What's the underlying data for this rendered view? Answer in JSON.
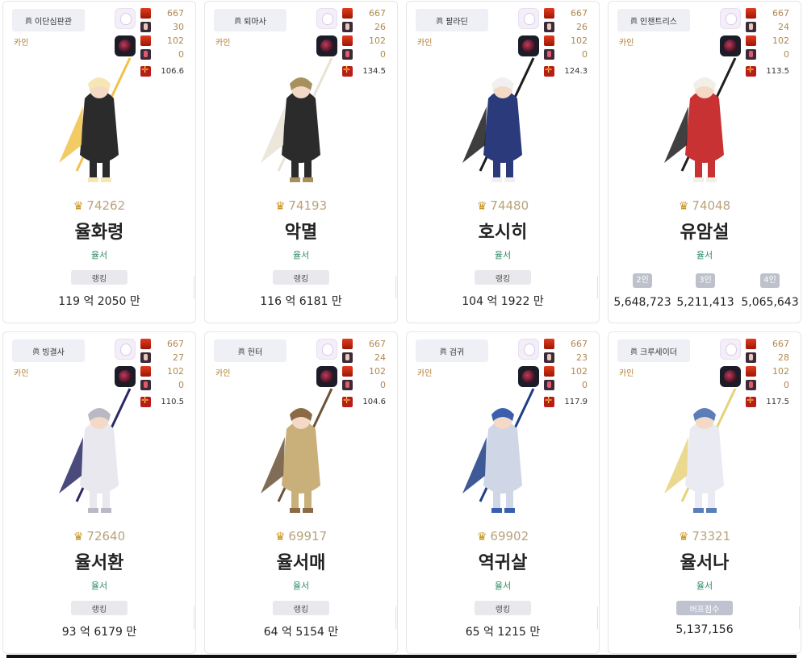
{
  "cards": [
    {
      "job": "이단심판관",
      "server": "카인",
      "stats": {
        "a": "667",
        "b": "30",
        "c": "102",
        "d": "0",
        "e": "106.6"
      },
      "score": "74262",
      "name": "율화령",
      "guild": "율서",
      "button": "랭킹",
      "value": "119 억 2050 만"
    },
    {
      "job": "퇴마사",
      "server": "카인",
      "stats": {
        "a": "667",
        "b": "26",
        "c": "102",
        "d": "0",
        "e": "134.5"
      },
      "score": "74193",
      "name": "악멸",
      "guild": "율서",
      "button": "랭킹",
      "value": "116 억 6181 만"
    },
    {
      "job": "팔라딘",
      "server": "카인",
      "stats": {
        "a": "667",
        "b": "26",
        "c": "102",
        "d": "0",
        "e": "124.3"
      },
      "score": "74480",
      "name": "호시히",
      "guild": "율서",
      "button": "랭킹",
      "value": "104 억 1922 만"
    },
    {
      "job": "인챈트리스",
      "server": "카인",
      "stats": {
        "a": "667",
        "b": "24",
        "c": "102",
        "d": "0",
        "e": "113.5"
      },
      "score": "74048",
      "name": "유암설",
      "guild": "율서",
      "party": [
        {
          "label": "2인",
          "value": "5,648,723"
        },
        {
          "label": "3인",
          "value": "5,211,413"
        },
        {
          "label": "4인",
          "value": "5,065,643"
        }
      ]
    },
    {
      "job": "빙결사",
      "server": "카인",
      "stats": {
        "a": "667",
        "b": "27",
        "c": "102",
        "d": "0",
        "e": "110.5"
      },
      "score": "72640",
      "name": "율서환",
      "guild": "율서",
      "button": "랭킹",
      "value": "93 억 6179 만"
    },
    {
      "job": "헌터",
      "server": "카인",
      "stats": {
        "a": "667",
        "b": "24",
        "c": "102",
        "d": "0",
        "e": "104.6"
      },
      "score": "69917",
      "name": "율서매",
      "guild": "율서",
      "button": "랭킹",
      "value": "64 억 5154 만"
    },
    {
      "job": "검귀",
      "server": "카인",
      "stats": {
        "a": "667",
        "b": "23",
        "c": "102",
        "d": "0",
        "e": "117.9"
      },
      "score": "69902",
      "name": "역귀살",
      "guild": "율서",
      "button": "랭킹",
      "value": "65 억 1215 만"
    },
    {
      "job": "크루세이더",
      "server": "카인",
      "stats": {
        "a": "667",
        "b": "28",
        "c": "102",
        "d": "0",
        "e": "117.5"
      },
      "score": "73321",
      "name": "율서나",
      "guild": "율서",
      "button": "버프점수",
      "value": "5,137,156"
    }
  ]
}
